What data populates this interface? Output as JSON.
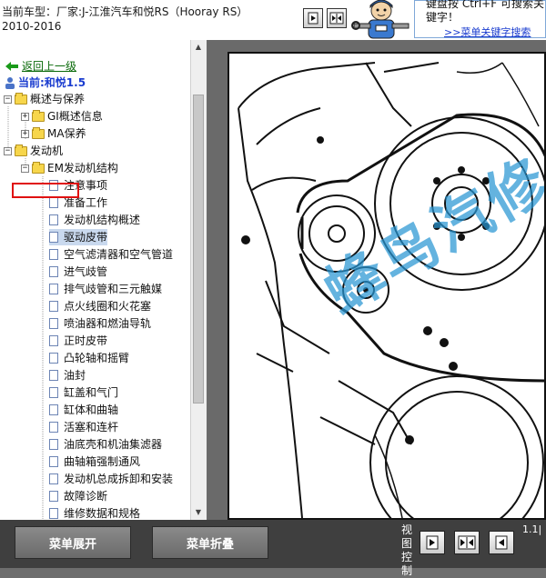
{
  "header": {
    "car_line1": "当前车型：厂家:J-江淮汽车和悦RS（Hooray RS）",
    "car_line2": "2010-2016",
    "tip_text": "键盘按 Ctrl+F 可搜索关键字！",
    "tip_link": ">>菜单关键字搜索"
  },
  "sidebar": {
    "back_label": "返回上一级",
    "current_label": "当前:和悦1.5",
    "folders": {
      "overview": "概述与保养",
      "gi": "GI概述信息",
      "ma": "MA保养",
      "engine": "发动机",
      "em": "EM发动机结构"
    },
    "items": [
      "注意事项",
      "准备工作",
      "发动机结构概述",
      "驱动皮带",
      "空气滤清器和空气管道",
      "进气歧管",
      "排气歧管和三元触媒",
      "点火线圈和火花塞",
      "喷油器和燃油导轨",
      "正时皮带",
      "凸轮轴和摇臂",
      "油封",
      "缸盖和气门",
      "缸体和曲轴",
      "活塞和连杆",
      "油底壳和机油集滤器",
      "曲轴箱强制通风",
      "发动机总成拆卸和安装",
      "故障诊断",
      "维修数据和规格"
    ],
    "selected_index": 3
  },
  "main": {
    "watermark": "蜂鸟汽修"
  },
  "bottom": {
    "expand_label": "菜单展开",
    "collapse_label": "菜单折叠",
    "view_control_label": "视图控制",
    "zoom_text": "1.1|"
  }
}
